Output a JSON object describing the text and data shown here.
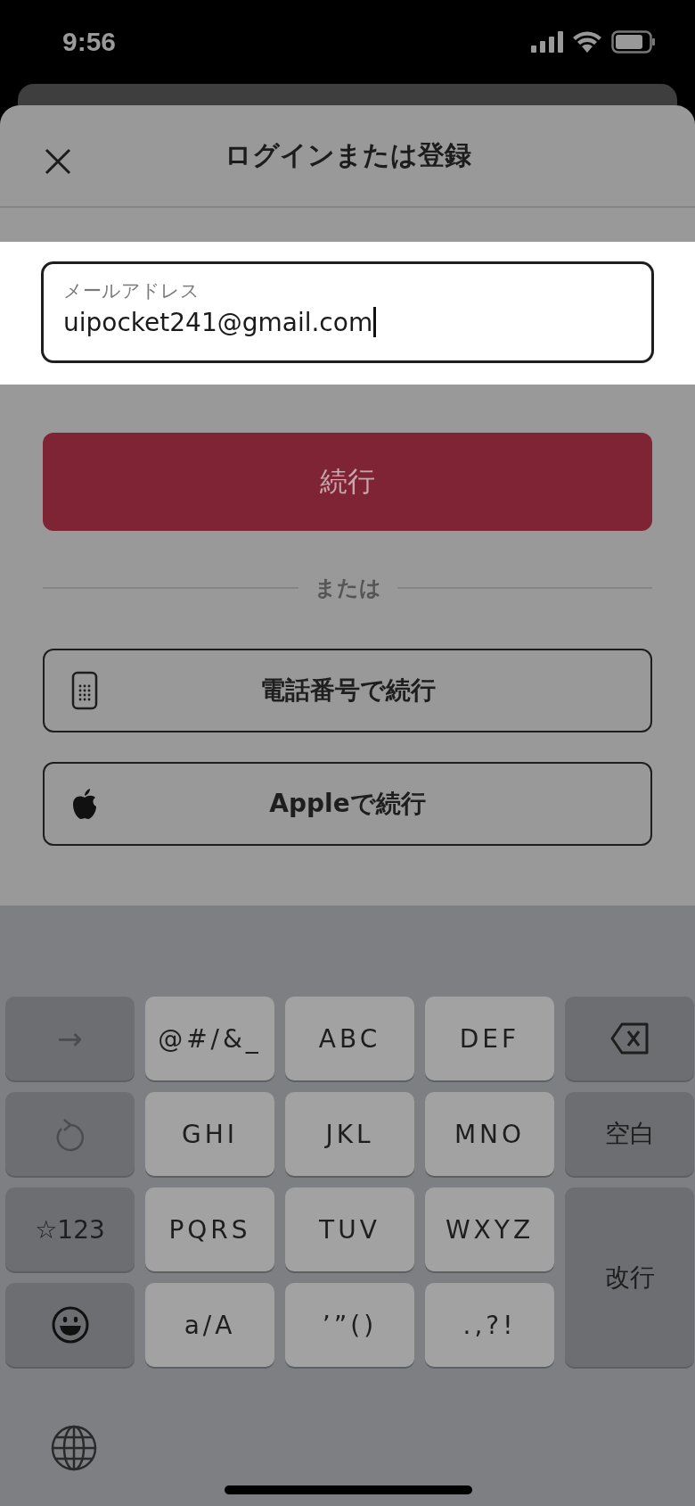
{
  "status_bar": {
    "time": "9:56"
  },
  "header": {
    "title": "ログインまたは登録"
  },
  "email_field": {
    "label": "メールアドレス",
    "value": "uipocket241@gmail.com"
  },
  "continue_button": {
    "label": "続行"
  },
  "divider_text": "または",
  "alt_buttons": [
    {
      "kind": "phone",
      "label": "電話番号で続行"
    },
    {
      "kind": "apple",
      "label": "Appleで続行"
    }
  ],
  "keyboard": {
    "keys": [
      {
        "kind": "arrow",
        "label": "→"
      },
      {
        "kind": "letter",
        "label": "@#/&_"
      },
      {
        "kind": "letter",
        "label": "ABC"
      },
      {
        "kind": "letter",
        "label": "DEF"
      },
      {
        "kind": "backspace"
      },
      {
        "kind": "undo"
      },
      {
        "kind": "letter",
        "label": "GHI"
      },
      {
        "kind": "letter",
        "label": "JKL"
      },
      {
        "kind": "letter",
        "label": "MNO"
      },
      {
        "kind": "function",
        "label": "空白"
      },
      {
        "kind": "function",
        "label": "☆123"
      },
      {
        "kind": "letter",
        "label": "PQRS"
      },
      {
        "kind": "letter",
        "label": "TUV"
      },
      {
        "kind": "letter",
        "label": "WXYZ"
      },
      {
        "kind": "return",
        "label": "改行"
      },
      {
        "kind": "emoji"
      },
      {
        "kind": "letter",
        "label": "a/A"
      },
      {
        "kind": "letter",
        "label": "’”()"
      },
      {
        "kind": "letter",
        "label": ".,?!"
      }
    ]
  }
}
